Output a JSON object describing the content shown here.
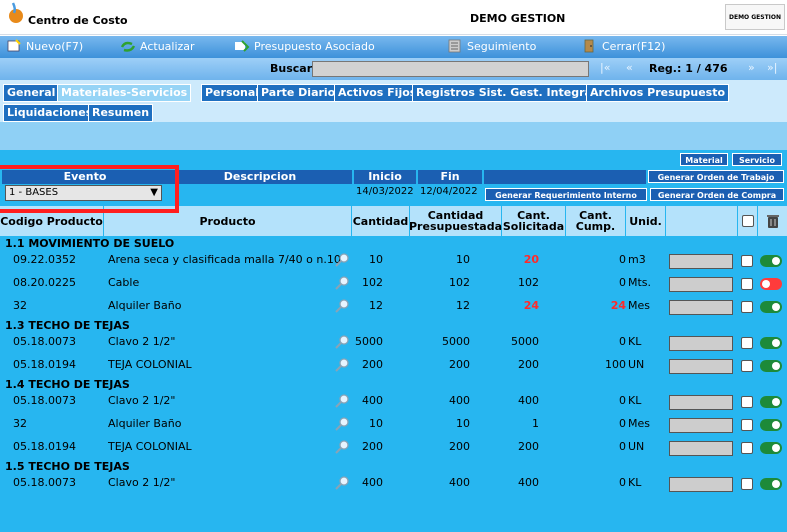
{
  "app": {
    "title_left": "Centro de Costo",
    "title_center": "DEMO GESTION",
    "brand": "DEMO GESTION"
  },
  "toolbar": {
    "nuevo": "Nuevo(F7)",
    "actualizar": "Actualizar",
    "presupuesto": "Presupuesto Asociado",
    "seguimiento": "Seguimiento",
    "cerrar": "Cerrar(F12)"
  },
  "search": {
    "label": "Buscar",
    "value": "",
    "first": "|«",
    "prev": "«",
    "reg": "Reg.: 1 / 476",
    "next": "»",
    "last": "»|"
  },
  "tabs": [
    "General",
    "Materiales-Servicios",
    "Personal",
    "Parte Diario",
    "Activos Fijos",
    "Registros Sist. Gest. Integral",
    "Archivos Presupuesto",
    "Liquidaciones",
    "Resumen"
  ],
  "active_tab": "Materiales-Servicios",
  "buttons": {
    "material": "Material",
    "servicio": "Servicio",
    "orden_trabajo": "Generar Orden de Trabajo",
    "requerimiento": "Generar Requerimiento Interno",
    "orden_compra": "Generar Orden de Compra"
  },
  "evento": {
    "header_evento": "Evento",
    "header_descripcion": "Descripcion",
    "header_inicio": "Inicio",
    "header_fin": "Fin",
    "selected": "1 - BASES",
    "inicio": "14/03/2022",
    "fin": "12/04/2022"
  },
  "table": {
    "headers": {
      "codigo": "Codigo Producto",
      "producto": "Producto",
      "cantidad": "Cantidad",
      "cant_presupuestada": "Cantidad Presupuestada",
      "cant_solicitada": "Cant. Solicitada",
      "cant_cump": "Cant. Cump.",
      "unid": "Unid."
    },
    "groups": [
      {
        "title": "1.1 MOVIMIENTO DE SUELO",
        "rows": [
          {
            "codigo": "09.22.0352",
            "producto": "Arena seca y clasificada malla 7/40 o n.10",
            "cantidad": "10",
            "presupuestada": "10",
            "solicitada": "20",
            "solicitada_red": true,
            "cump": "0",
            "cump_red": false,
            "unid": "m3",
            "has_input": true,
            "toggle": "on"
          },
          {
            "codigo": "08.20.0225",
            "producto": "Cable",
            "cantidad": "102",
            "presupuestada": "102",
            "solicitada": "102",
            "solicitada_red": false,
            "cump": "0",
            "cump_red": false,
            "unid": "Mts.",
            "has_input": true,
            "toggle": "off"
          },
          {
            "codigo": "32",
            "producto": "Alquiler Baño",
            "cantidad": "12",
            "presupuestada": "12",
            "solicitada": "24",
            "solicitada_red": true,
            "cump": "24",
            "cump_red": true,
            "unid": "Mes",
            "has_input": true,
            "toggle": "on"
          }
        ]
      },
      {
        "title": "1.3 TECHO DE TEJAS",
        "rows": [
          {
            "codigo": "05.18.0073",
            "producto": "Clavo 2 1/2\"",
            "cantidad": "5000",
            "presupuestada": "5000",
            "solicitada": "5000",
            "solicitada_red": false,
            "cump": "0",
            "cump_red": false,
            "unid": "KL",
            "has_input": true,
            "toggle": "on"
          },
          {
            "codigo": "05.18.0194",
            "producto": "TEJA COLONIAL",
            "cantidad": "200",
            "presupuestada": "200",
            "solicitada": "200",
            "solicitada_red": false,
            "cump": "100",
            "cump_red": false,
            "unid": "UN",
            "has_input": true,
            "toggle": "on"
          }
        ]
      },
      {
        "title": "1.4 TECHO DE TEJAS",
        "rows": [
          {
            "codigo": "05.18.0073",
            "producto": "Clavo 2 1/2\"",
            "cantidad": "400",
            "presupuestada": "400",
            "solicitada": "400",
            "solicitada_red": false,
            "cump": "0",
            "cump_red": false,
            "unid": "KL",
            "has_input": true,
            "toggle": "on"
          },
          {
            "codigo": "32",
            "producto": "Alquiler Baño",
            "cantidad": "10",
            "presupuestada": "10",
            "solicitada": "1",
            "solicitada_red": false,
            "cump": "0",
            "cump_red": false,
            "unid": "Mes",
            "has_input": true,
            "toggle": "on"
          },
          {
            "codigo": "05.18.0194",
            "producto": "TEJA COLONIAL",
            "cantidad": "200",
            "presupuestada": "200",
            "solicitada": "200",
            "solicitada_red": false,
            "cump": "0",
            "cump_red": false,
            "unid": "UN",
            "has_input": true,
            "toggle": "on"
          }
        ]
      },
      {
        "title": "1.5 TECHO DE TEJAS",
        "rows": [
          {
            "codigo": "05.18.0073",
            "producto": "Clavo 2 1/2\"",
            "cantidad": "400",
            "presupuestada": "400",
            "solicitada": "400",
            "solicitada_red": false,
            "cump": "0",
            "cump_red": false,
            "unid": "KL",
            "has_input": true,
            "toggle": "on"
          }
        ]
      }
    ]
  },
  "colors": {
    "toolbar": "#3d91da",
    "content_bg": "#27b6f0",
    "header_bg": "#b4e2fb",
    "button_dark": "#1b5fb2",
    "highlight": "#ff1f1f"
  }
}
